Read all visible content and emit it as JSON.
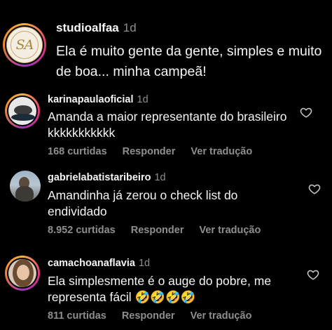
{
  "caption": {
    "username": "studioalfaa",
    "time": "1d",
    "text": "Ela é muito gente da gente, simples e muito de boa... minha campeã!",
    "logo_text": "SA"
  },
  "comments": [
    {
      "username": "karinapaulaoficial",
      "time": "1d",
      "text": "Amanda a maior representante do brasileiro kkkkkkkkkkk",
      "likes": "168 curtidas",
      "reply": "Responder",
      "translate": "Ver tradução",
      "icon": "heart-outline-icon"
    },
    {
      "username": "gabrielabatistaribeiro",
      "time": "1d",
      "text": "Amandinha já zerou o check list do endividado",
      "likes": "8.952 curtidas",
      "reply": "Responder",
      "translate": "Ver tradução",
      "icon": "heart-outline-icon"
    },
    {
      "username": "camachoanaflavia",
      "time": "1d",
      "text": "Ela simplesmente é o auge do pobre, me representa fácil 🤣🤣🤣🤣",
      "likes": "811 curtidas",
      "reply": "Responder",
      "translate": "Ver tradução",
      "icon": "heart-outline-icon"
    }
  ],
  "colors": {
    "background": "#000000",
    "text": "#f5f5f5",
    "muted": "#8e8e8e",
    "story_ring_start": "#f5b13c",
    "story_ring_mid": "#e2337a"
  }
}
